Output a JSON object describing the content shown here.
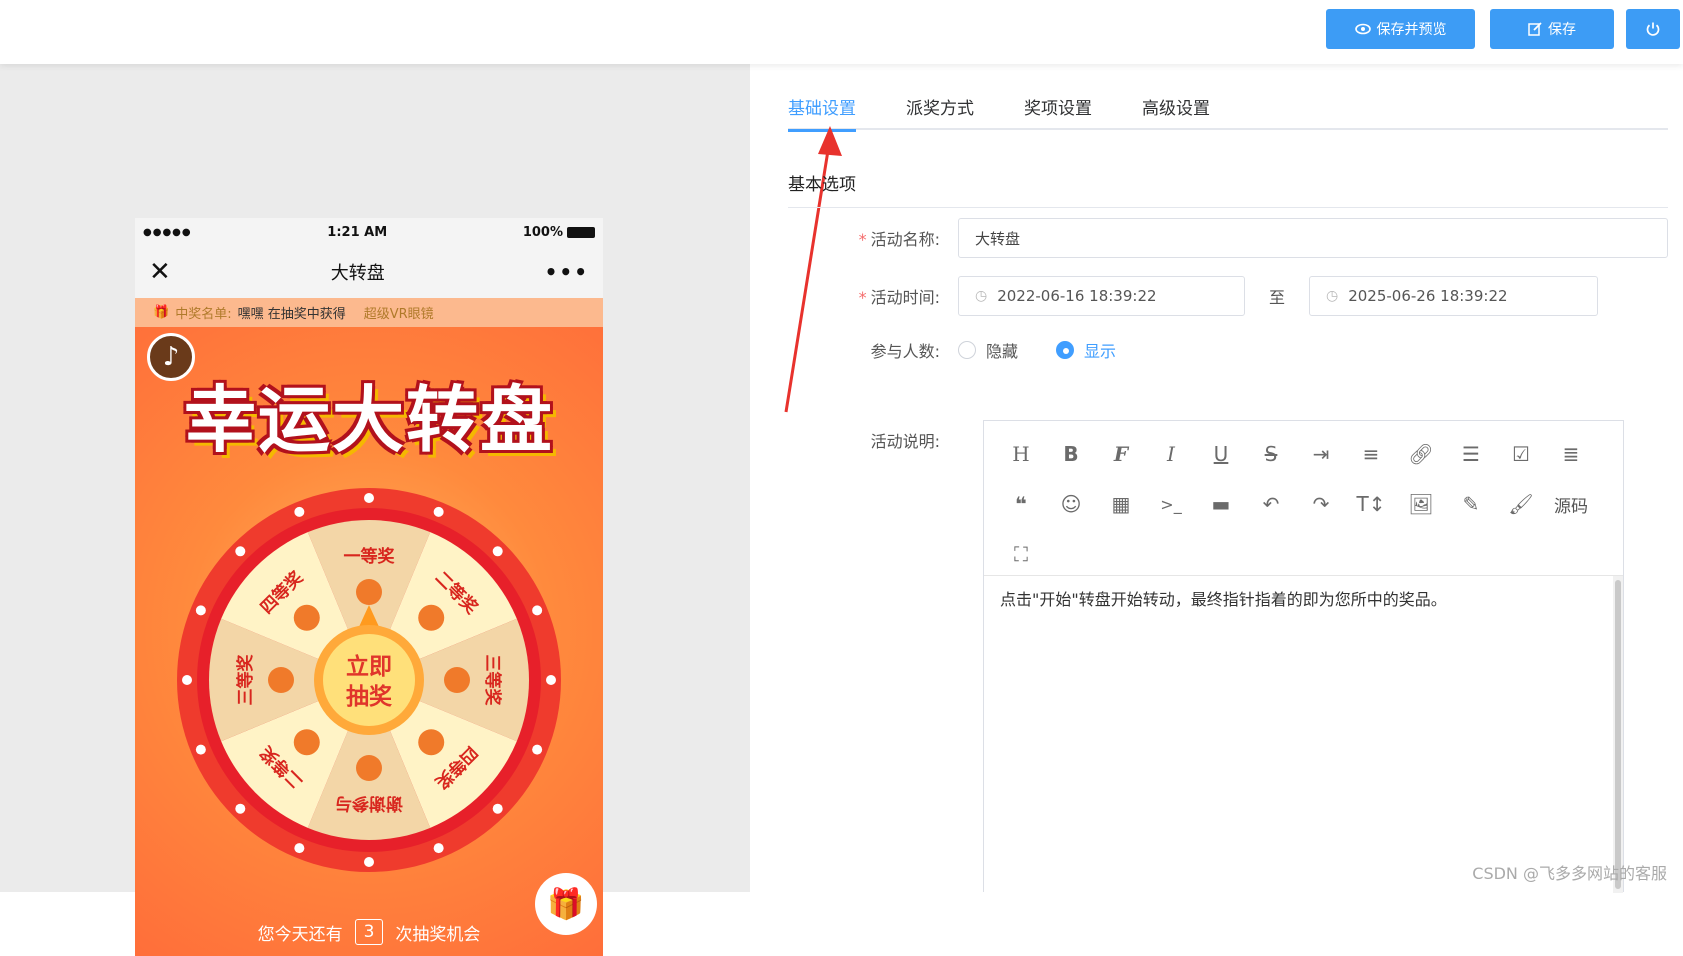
{
  "toolbar": {
    "preview_label": "保存并预览",
    "save_label": "保存"
  },
  "phone": {
    "status": {
      "signal": "●●●●●",
      "time": "1:21 AM",
      "battery": "100%"
    },
    "nav": {
      "close": "✕",
      "title": "大转盘",
      "more": "•••"
    },
    "ticker": {
      "label": "中奖名单:",
      "winner": "嘿嘿 在抽奖中获得",
      "prize": "超级VR眼镜"
    },
    "game": {
      "title": "幸运大转盘",
      "prizes": [
        "一等奖",
        "二等奖",
        "三等奖",
        "四等奖",
        "谢谢参与",
        "二等奖",
        "三等奖",
        "四等奖"
      ],
      "button_line1": "立即",
      "button_line2": "抽奖",
      "chances_prefix": "您今天还有",
      "chances_count": "3",
      "chances_suffix": "次抽奖机会"
    }
  },
  "tabs": [
    "基础设置",
    "派奖方式",
    "奖项设置",
    "高级设置"
  ],
  "section_title": "基本选项",
  "form": {
    "name_label": "活动名称:",
    "name_value": "大转盘",
    "time_label": "活动时间:",
    "start": "2022-06-16 18:39:22",
    "separator": "至",
    "end": "2025-06-26 18:39:22",
    "participants_label": "参与人数:",
    "options": [
      "隐藏",
      "显示"
    ],
    "selected_option": "显示",
    "desc_label": "活动说明:"
  },
  "editor": {
    "tools": [
      "H",
      "B",
      "F",
      "I",
      "U",
      "S",
      "indent",
      "align",
      "link",
      "list",
      "check",
      "paragraph",
      "quote",
      "emoji",
      "table",
      "code",
      "hr",
      "undo",
      "redo",
      "size",
      "image",
      "pen",
      "brush",
      "源码",
      "fullscreen"
    ],
    "source_label": "源码",
    "content": "点击\"开始\"转盘开始转动，最终指针指着的即为您所中的奖品。"
  },
  "watermark": "CSDN @飞多多网站的客服",
  "colors": {
    "accent": "#409eff",
    "button": "#3d9cf5",
    "wheel_red": "#f0392b"
  }
}
